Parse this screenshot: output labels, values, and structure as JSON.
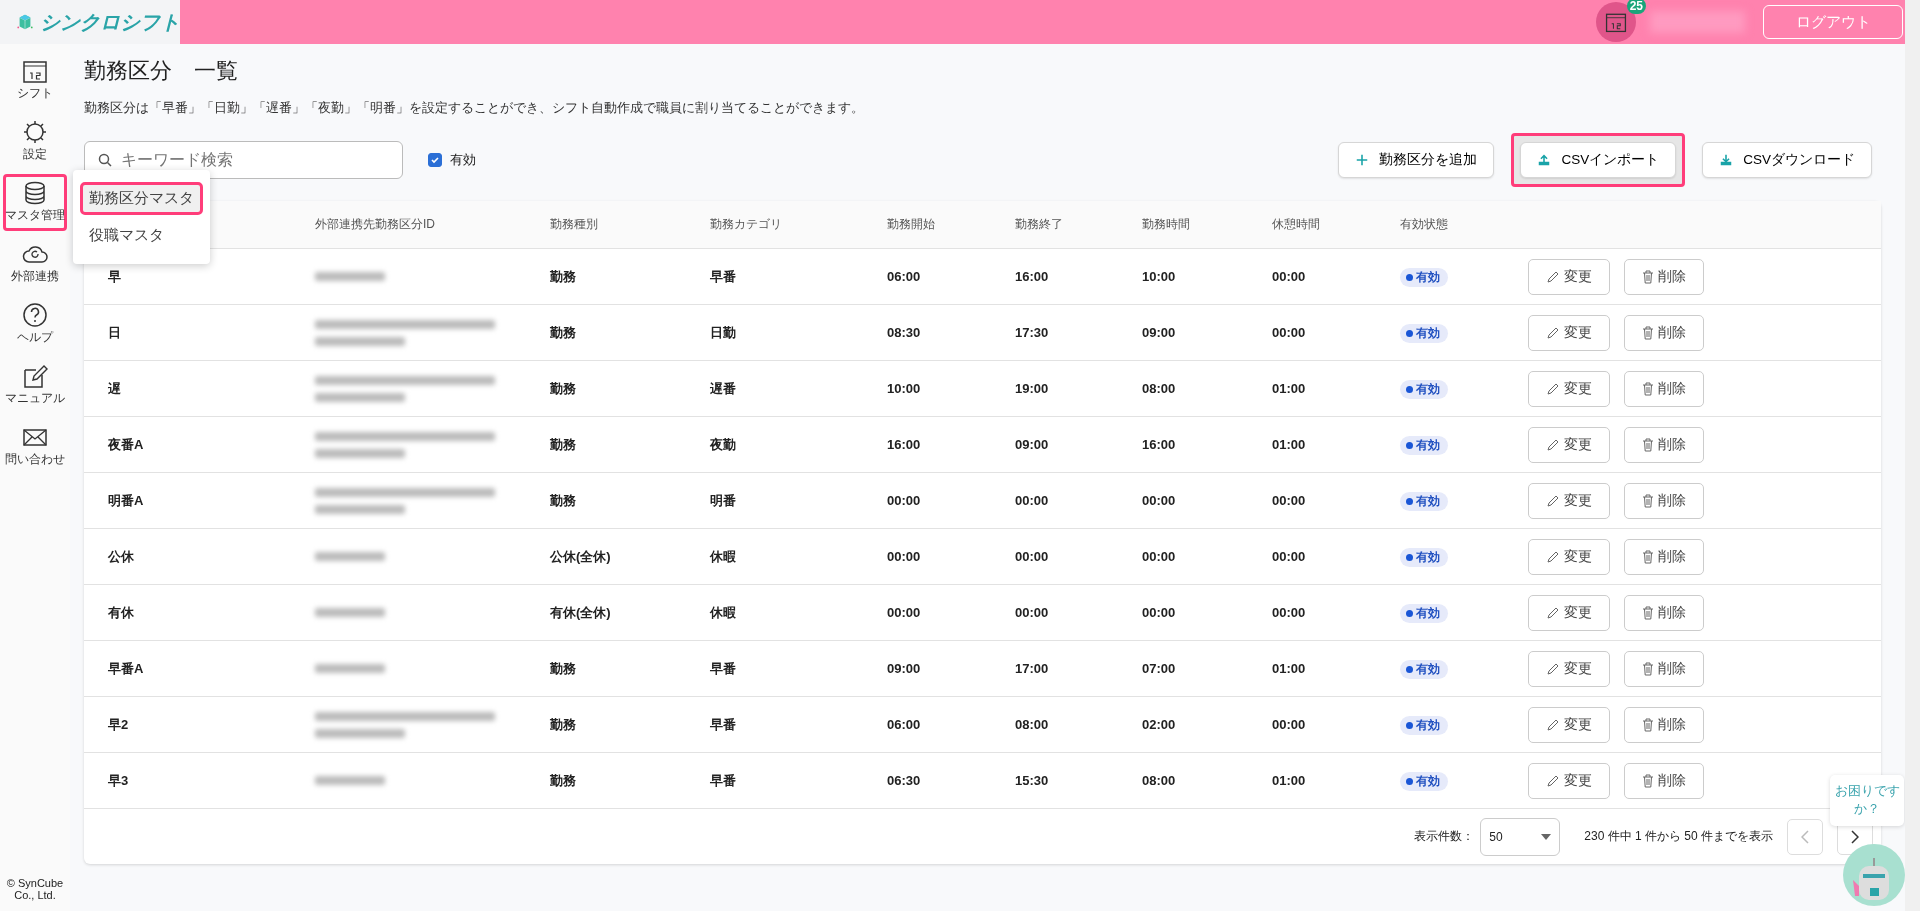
{
  "header": {
    "logo_text": "シンクロシフト",
    "notification_count": "25",
    "logout": "ログアウト"
  },
  "sidebar": {
    "items": [
      {
        "label": "シフト",
        "highlighted": false
      },
      {
        "label": "設定",
        "highlighted": false
      },
      {
        "label": "マスタ管理",
        "highlighted": true
      },
      {
        "label": "外部連携",
        "highlighted": false
      },
      {
        "label": "ヘルプ",
        "highlighted": false
      },
      {
        "label": "マニュアル",
        "highlighted": false
      },
      {
        "label": "問い合わせ",
        "highlighted": false
      }
    ],
    "copyright": "© SynCube Co., Ltd."
  },
  "submenu": {
    "items": [
      {
        "label": "勤務区分マスタ",
        "highlighted": true
      },
      {
        "label": "役職マスタ",
        "highlighted": false
      }
    ]
  },
  "page": {
    "title": "勤務区分　一覧",
    "description": "勤務区分は「早番」「日勤」「遅番」「夜勤」「明番」を設定することができ、シフト自動作成で職員に割り当てることができます。"
  },
  "search": {
    "placeholder": "キーワード検索"
  },
  "filter": {
    "label": "有効",
    "checked": true
  },
  "actions": [
    {
      "label": "勤務区分を追加",
      "highlighted": false
    },
    {
      "label": "CSVインポート",
      "highlighted": true
    },
    {
      "label": "CSVダウンロード",
      "highlighted": false
    }
  ],
  "table": {
    "columns": [
      "外部連携先勤務区分ID",
      "勤務種別",
      "勤務カテゴリ",
      "勤務開始",
      "勤務終了",
      "勤務時間",
      "休憩時間",
      "有効状態"
    ],
    "rows": [
      {
        "name": "早",
        "kind": "short",
        "type": "勤務",
        "category": "早番",
        "start": "06:00",
        "end": "16:00",
        "duration": "10:00",
        "break": "00:00",
        "status": "有効",
        "edit": "変更",
        "delete": "削除"
      },
      {
        "name": "日",
        "kind": "long",
        "type": "勤務",
        "category": "日勤",
        "start": "08:30",
        "end": "17:30",
        "duration": "09:00",
        "break": "00:00",
        "status": "有効",
        "edit": "変更",
        "delete": "削除"
      },
      {
        "name": "遅",
        "kind": "long",
        "type": "勤務",
        "category": "遅番",
        "start": "10:00",
        "end": "19:00",
        "duration": "08:00",
        "break": "01:00",
        "status": "有効",
        "edit": "変更",
        "delete": "削除"
      },
      {
        "name": "夜番A",
        "kind": "long",
        "type": "勤務",
        "category": "夜勤",
        "start": "16:00",
        "end": "09:00",
        "duration": "16:00",
        "break": "01:00",
        "status": "有効",
        "edit": "変更",
        "delete": "削除"
      },
      {
        "name": "明番A",
        "kind": "long",
        "type": "勤務",
        "category": "明番",
        "start": "00:00",
        "end": "00:00",
        "duration": "00:00",
        "break": "00:00",
        "status": "有効",
        "edit": "変更",
        "delete": "削除"
      },
      {
        "name": "公休",
        "kind": "short",
        "type": "公休(全休)",
        "category": "休暇",
        "start": "00:00",
        "end": "00:00",
        "duration": "00:00",
        "break": "00:00",
        "status": "有効",
        "edit": "変更",
        "delete": "削除"
      },
      {
        "name": "有休",
        "kind": "short",
        "type": "有休(全休)",
        "category": "休暇",
        "start": "00:00",
        "end": "00:00",
        "duration": "00:00",
        "break": "00:00",
        "status": "有効",
        "edit": "変更",
        "delete": "削除"
      },
      {
        "name": "早番A",
        "kind": "short",
        "type": "勤務",
        "category": "早番",
        "start": "09:00",
        "end": "17:00",
        "duration": "07:00",
        "break": "01:00",
        "status": "有効",
        "edit": "変更",
        "delete": "削除"
      },
      {
        "name": "早2",
        "kind": "long",
        "type": "勤務",
        "category": "早番",
        "start": "06:00",
        "end": "08:00",
        "duration": "02:00",
        "break": "00:00",
        "status": "有効",
        "edit": "変更",
        "delete": "削除"
      },
      {
        "name": "早3",
        "kind": "short",
        "type": "勤務",
        "category": "早番",
        "start": "06:30",
        "end": "15:30",
        "duration": "08:00",
        "break": "01:00",
        "status": "有効",
        "edit": "変更",
        "delete": "削除"
      }
    ]
  },
  "pagination": {
    "per_page_label": "表示件数：",
    "per_page": "50",
    "summary": "230 件中 1 件から 50 件までを表示"
  },
  "chat": {
    "bubble": "お困りですか？"
  }
}
